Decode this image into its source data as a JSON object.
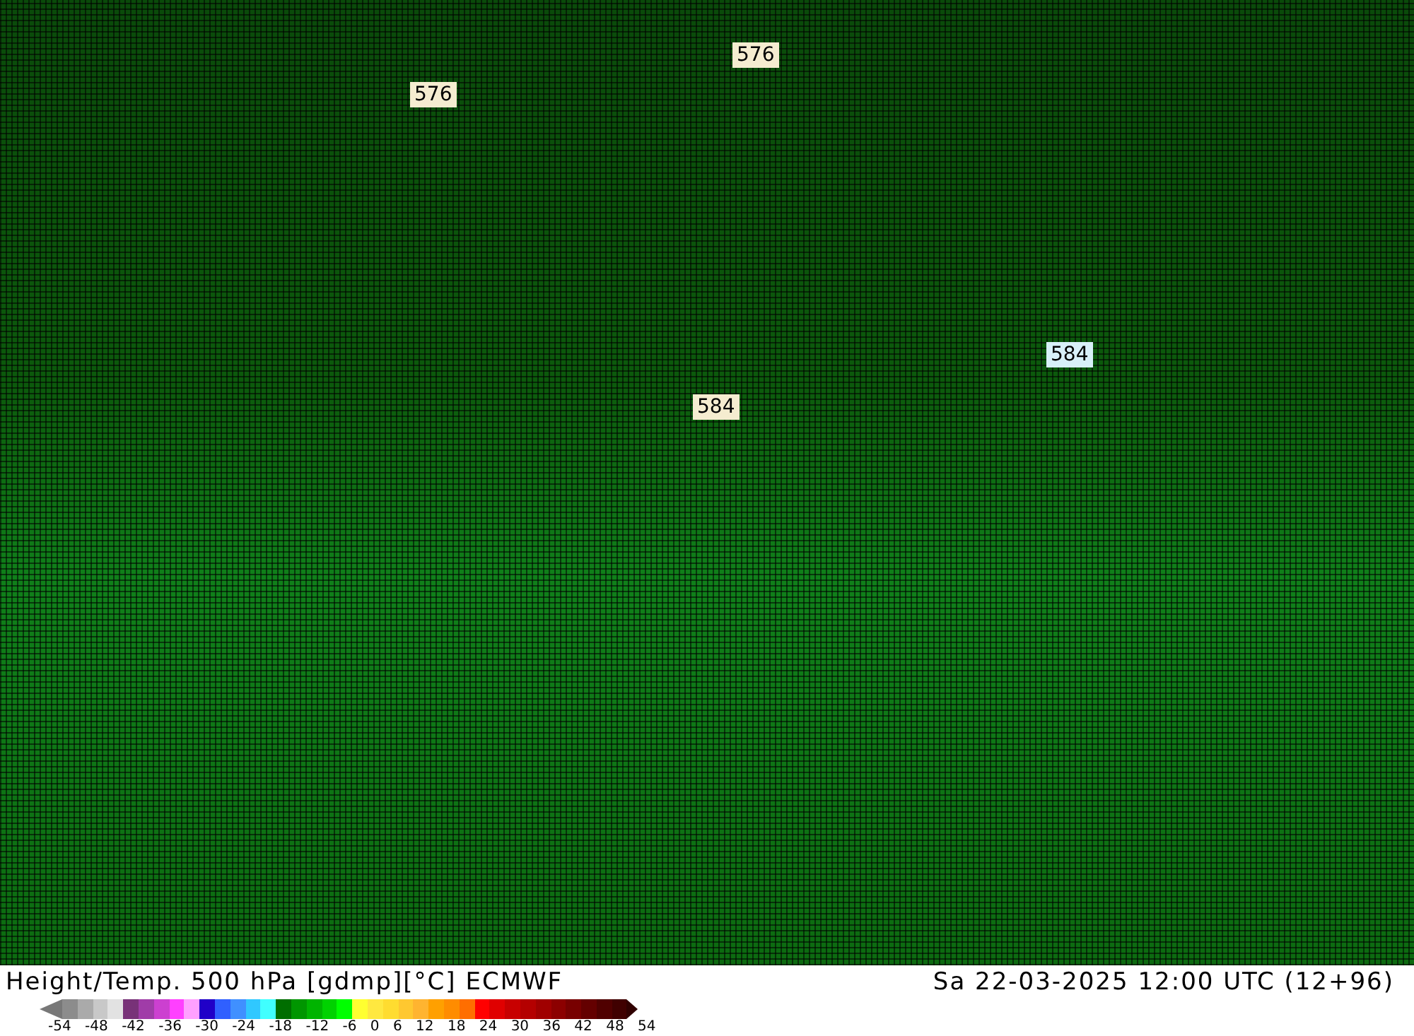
{
  "map": {
    "contour_labels": [
      {
        "text": "576",
        "color": "#f5ecd0"
      },
      {
        "text": "576",
        "color": "#f5ecd0"
      },
      {
        "text": "584",
        "color": "#f5ecd0"
      },
      {
        "text": "584",
        "color": "#d8f0f8"
      }
    ]
  },
  "footer": {
    "title": "Height/Temp. 500 hPa [gdmp][°C] ECMWF",
    "datetime": "Sa 22-03-2025 12:00 UTC (12+96)"
  },
  "legend": {
    "swatches": [
      {
        "kind": "arrow-left",
        "color": "#787878"
      },
      {
        "color": "#8c8c8c"
      },
      {
        "color": "#aaaaaa"
      },
      {
        "color": "#c8c8c8"
      },
      {
        "color": "#e2e2e2"
      },
      {
        "color": "#783278"
      },
      {
        "color": "#a03ca8"
      },
      {
        "color": "#cc40d0"
      },
      {
        "color": "#ff40ff"
      },
      {
        "color": "#ffa0ff"
      },
      {
        "color": "#2000c8"
      },
      {
        "color": "#3060ff"
      },
      {
        "color": "#4090ff"
      },
      {
        "color": "#30c8ff"
      },
      {
        "color": "#40ffff"
      },
      {
        "color": "#006e00"
      },
      {
        "color": "#009600"
      },
      {
        "color": "#00b400"
      },
      {
        "color": "#00d200"
      },
      {
        "color": "#00ff00"
      },
      {
        "color": "#ffff30"
      },
      {
        "color": "#ffe840"
      },
      {
        "color": "#ffdc30"
      },
      {
        "color": "#ffc830"
      },
      {
        "color": "#ffb430"
      },
      {
        "color": "#ffa000"
      },
      {
        "color": "#ff8c00"
      },
      {
        "color": "#ff6e00"
      },
      {
        "color": "#ff0000"
      },
      {
        "color": "#e00000"
      },
      {
        "color": "#c80000"
      },
      {
        "color": "#b40000"
      },
      {
        "color": "#a00000"
      },
      {
        "color": "#8c0000"
      },
      {
        "color": "#780000"
      },
      {
        "color": "#640000"
      },
      {
        "color": "#500000"
      },
      {
        "color": "#400000"
      },
      {
        "kind": "arrow-right",
        "color": "#300000"
      }
    ],
    "ticks": [
      "-54",
      "-48",
      "-42",
      "-36",
      "-30",
      "-24",
      "-18",
      "-12",
      "-6",
      "0",
      "6",
      "12",
      "18",
      "24",
      "30",
      "36",
      "42",
      "48",
      "54"
    ]
  }
}
